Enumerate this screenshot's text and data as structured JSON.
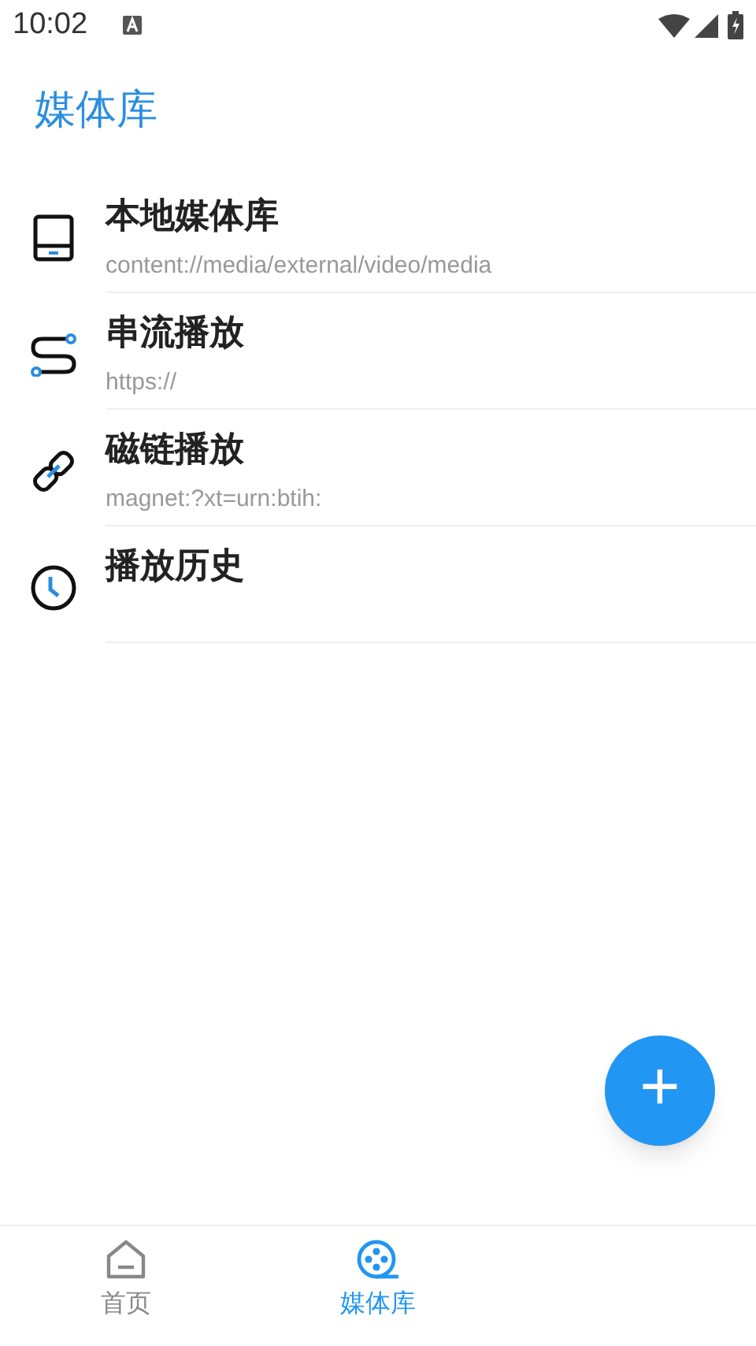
{
  "status_bar": {
    "time": "10:02"
  },
  "title": "媒体库",
  "items": [
    {
      "kind": "local",
      "title": "本地媒体库",
      "subtitle": "content://media/external/video/media"
    },
    {
      "kind": "stream",
      "title": "串流播放",
      "subtitle": "https://"
    },
    {
      "kind": "magnet",
      "title": "磁链播放",
      "subtitle": "magnet:?xt=urn:btih:"
    },
    {
      "kind": "history",
      "title": "播放历史"
    }
  ],
  "fab": {
    "label": "+"
  },
  "bottom_nav": [
    {
      "kind": "home",
      "label": "首页",
      "selected": false
    },
    {
      "kind": "media",
      "label": "媒体库",
      "selected": true
    }
  ]
}
